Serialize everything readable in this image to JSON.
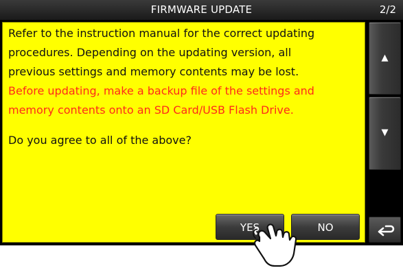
{
  "header": {
    "title": "FIRMWARE UPDATE",
    "page_indicator": "2/2"
  },
  "message": {
    "lines_black_top": [
      "Refer to the instruction manual for the correct updating",
      "procedures. Depending on the updating version, all",
      "previous settings and memory contents may be lost."
    ],
    "lines_red": [
      "Before updating, make a backup file of the settings and",
      "memory contents onto an SD Card/USB Flash Drive."
    ],
    "question": "Do you agree to all of the above?"
  },
  "buttons": {
    "yes_label": "YES",
    "no_label": "NO"
  },
  "side": {
    "up_icon": "▲",
    "down_icon": "▼",
    "back_icon": "return-arrow-icon"
  },
  "colors": {
    "panel_background": "#ffff00",
    "warning_text": "#ff2a1a",
    "body_text": "#111111",
    "screen_background": "#000000"
  }
}
